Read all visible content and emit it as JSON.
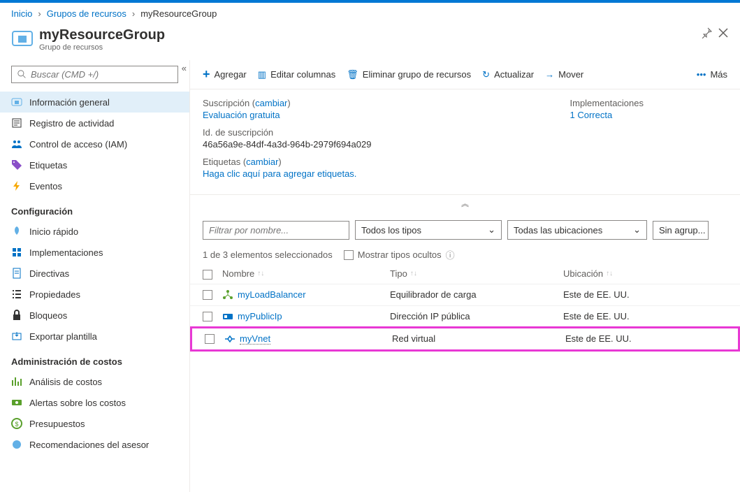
{
  "breadcrumb": {
    "home": "Inicio",
    "groups": "Grupos de recursos",
    "current": "myResourceGroup"
  },
  "header": {
    "title": "myResourceGroup",
    "subtitle": "Grupo de recursos"
  },
  "search_placeholder": "Buscar (CMD +/)",
  "sidebar": {
    "items": [
      {
        "label": "Información general"
      },
      {
        "label": "Registro de actividad"
      },
      {
        "label": "Control de acceso (IAM)"
      },
      {
        "label": "Etiquetas"
      },
      {
        "label": "Eventos"
      }
    ],
    "section_config": "Configuración",
    "config_items": [
      {
        "label": "Inicio rápido"
      },
      {
        "label": "Implementaciones"
      },
      {
        "label": "Directivas"
      },
      {
        "label": "Propiedades"
      },
      {
        "label": "Bloqueos"
      },
      {
        "label": "Exportar plantilla"
      }
    ],
    "section_cost": "Administración de costos",
    "cost_items": [
      {
        "label": "Análisis de costos"
      },
      {
        "label": "Alertas sobre los costos"
      },
      {
        "label": "Presupuestos"
      },
      {
        "label": "Recomendaciones del asesor"
      }
    ]
  },
  "toolbar": {
    "add": "Agregar",
    "edit_cols": "Editar columnas",
    "delete": "Eliminar grupo de recursos",
    "refresh": "Actualizar",
    "move": "Mover",
    "more": "Más"
  },
  "info": {
    "sub_label": "Suscripción (",
    "change": "cambiar",
    "close_paren": ")",
    "sub_value": "Evaluación gratuita",
    "subid_label": "Id. de suscripción",
    "subid_value": "46a56a9e-84df-4a3d-964b-2979f694a029",
    "tags_label": "Etiquetas (",
    "tags_hint": "Haga clic aquí para agregar etiquetas.",
    "impl_label": "Implementaciones",
    "impl_value": "1 Correcta"
  },
  "filters": {
    "name_ph": "Filtrar por nombre...",
    "types": "Todos los tipos",
    "locations": "Todas las ubicaciones",
    "group": "Sin agrup..."
  },
  "selection": {
    "count": "1 de 3 elementos seleccionados",
    "hidden": "Mostrar tipos ocultos"
  },
  "columns": {
    "name": "Nombre",
    "type": "Tipo",
    "location": "Ubicación"
  },
  "rows": [
    {
      "name": "myLoadBalancer",
      "type": "Equilibrador de carga",
      "location": "Este de EE. UU."
    },
    {
      "name": "myPublicIp",
      "type": "Dirección IP pública",
      "location": "Este de EE. UU."
    },
    {
      "name": "myVnet",
      "type": "Red virtual",
      "location": "Este de EE. UU."
    }
  ]
}
